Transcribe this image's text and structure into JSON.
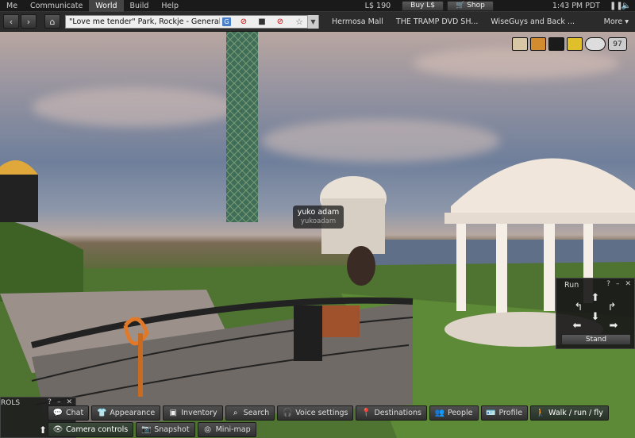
{
  "menubar": {
    "items": [
      {
        "label": "Me"
      },
      {
        "label": "Communicate"
      },
      {
        "label": "World"
      },
      {
        "label": "Build"
      },
      {
        "label": "Help"
      }
    ],
    "balance": "L$ 190",
    "buy_label": "Buy L$",
    "shop_label": "Shop",
    "clock": "1:43 PM PDT"
  },
  "navbar": {
    "location": "\"Love me tender\" Park, Rockje - General",
    "location_badge": "G",
    "favorites": [
      "Hermosa Mall",
      "THE TRAMP DVD SH...",
      "WiseGuys and Back ..."
    ],
    "more_label": "More"
  },
  "status": {
    "counter": "97"
  },
  "nametag": {
    "display_name": "yuko adam",
    "user_name": "yukoadam"
  },
  "run_panel": {
    "title": "Run",
    "stand_label": "Stand"
  },
  "controls_floater": {
    "title": "ROLS"
  },
  "toolbar": {
    "row1": [
      {
        "label": "Chat",
        "icon": "chat-icon"
      },
      {
        "label": "Appearance",
        "icon": "shirt-icon"
      },
      {
        "label": "Inventory",
        "icon": "inventory-icon"
      },
      {
        "label": "Search",
        "icon": "search-icon"
      },
      {
        "label": "Voice settings",
        "icon": "headset-icon"
      },
      {
        "label": "Destinations",
        "icon": "pin-icon"
      },
      {
        "label": "People",
        "icon": "people-icon"
      },
      {
        "label": "Profile",
        "icon": "profile-icon"
      },
      {
        "label": "Walk / run / fly",
        "icon": "walk-icon"
      }
    ],
    "row2": [
      {
        "label": "Camera controls",
        "icon": "eye-icon"
      },
      {
        "label": "Snapshot",
        "icon": "camera-icon"
      },
      {
        "label": "Mini-map",
        "icon": "minimap-icon"
      }
    ]
  },
  "colors": {
    "menubar_bg": "#1a1a1a",
    "navbar_bg": "#2b2b2b",
    "accent_blue": "#4a7fc9",
    "toolbar_button": "#404040"
  }
}
